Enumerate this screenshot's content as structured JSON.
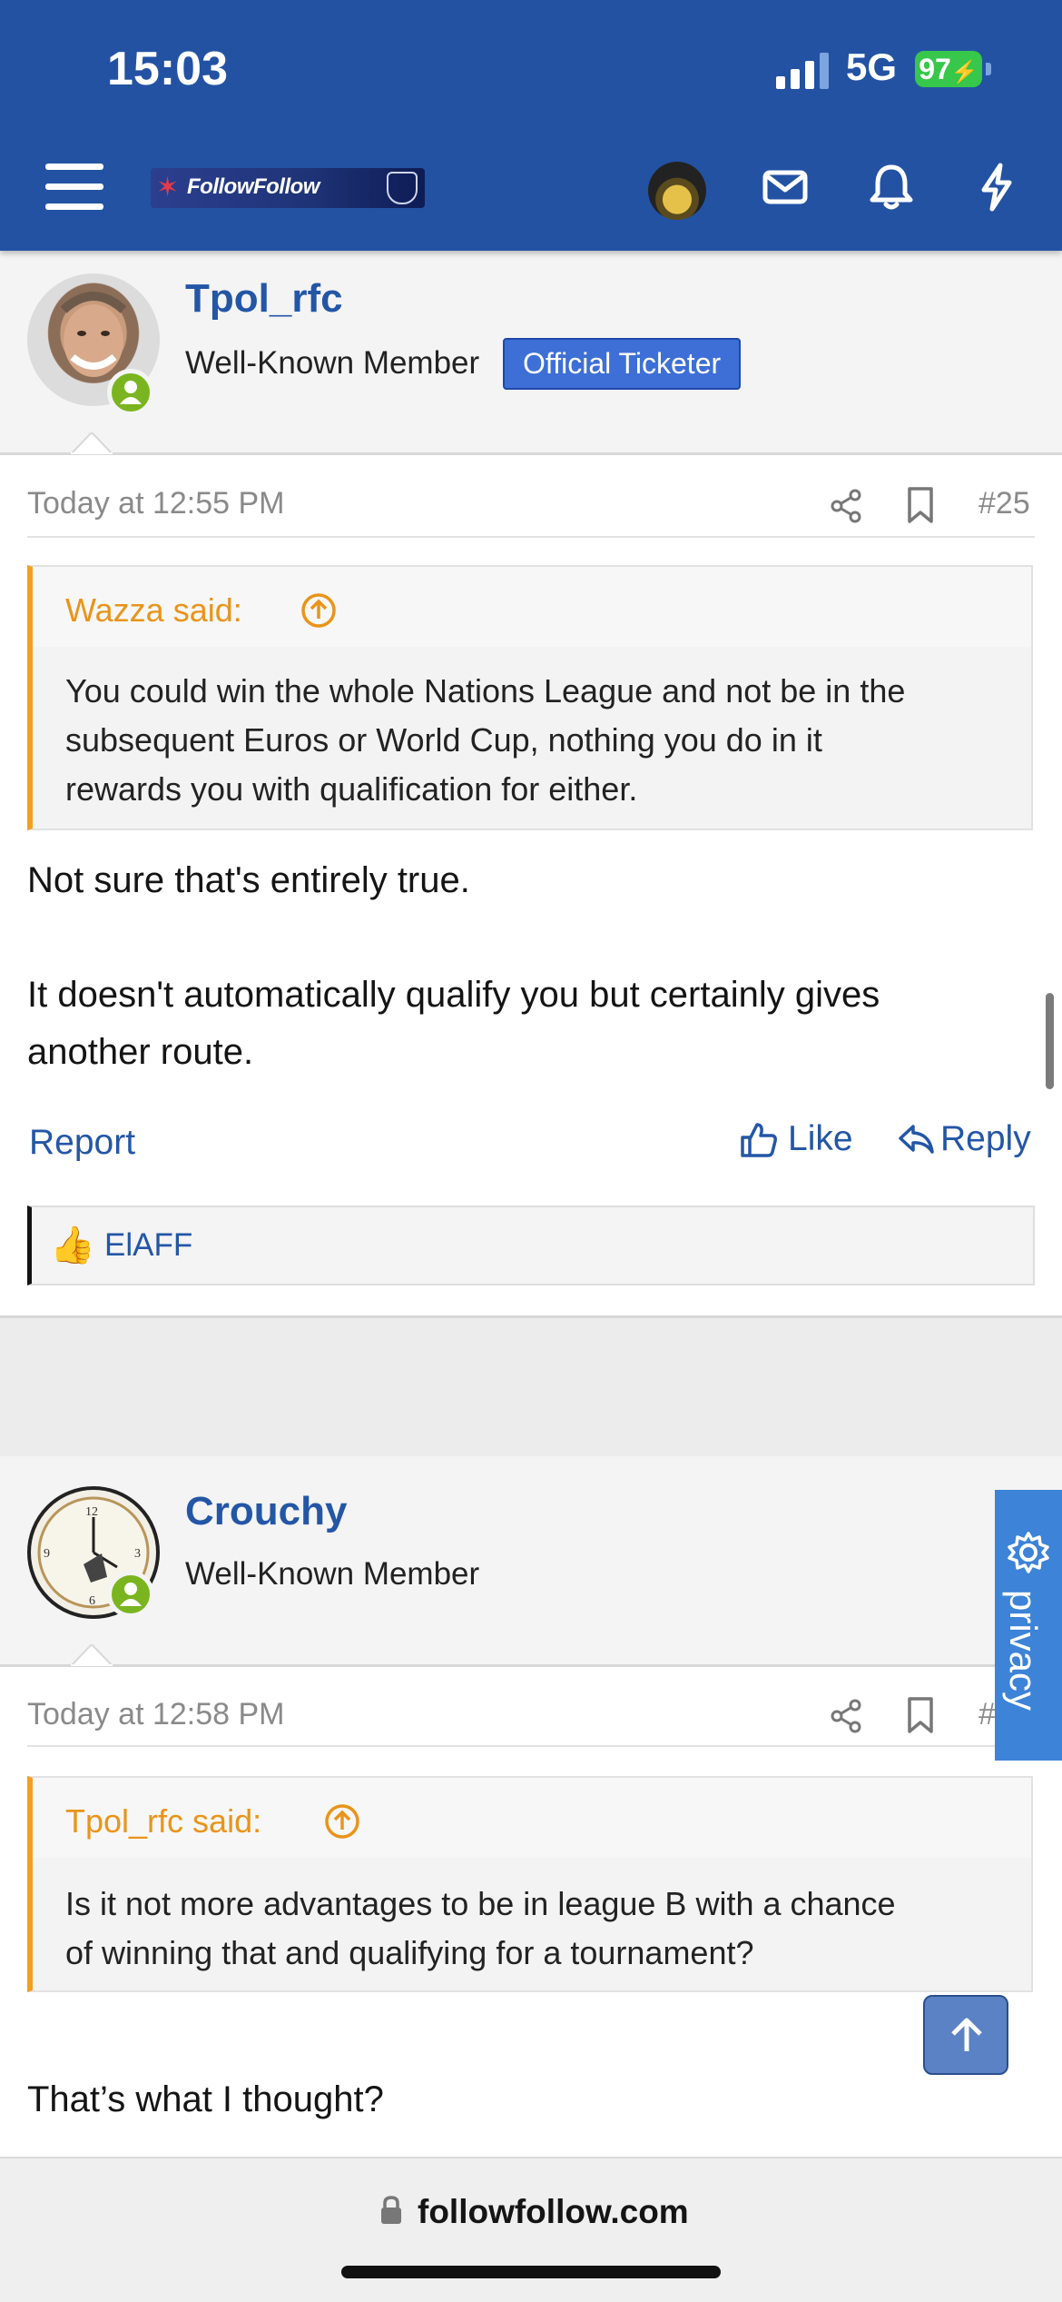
{
  "status_bar": {
    "time": "15:03",
    "network": "5G",
    "battery": "97"
  },
  "header": {
    "logo_text": "FollowFollow",
    "brand_color": "#2352a3"
  },
  "posts": [
    {
      "username": "Tpol_rfc",
      "user_title": "Well-Known Member",
      "banner": "Official Ticketer",
      "date": "Today at 12:55 PM",
      "post_number": "#25",
      "quote": {
        "author": "Wazza said:",
        "lines": [
          "You could win the whole Nations League and not be in the",
          "subsequent Euros or World Cup, nothing you do in it",
          "rewards you with qualification for either."
        ]
      },
      "message_lines": [
        "Not sure that's entirely true.",
        "It doesn't automatically qualify you but certainly gives",
        "another route."
      ],
      "actions": {
        "report": "Report",
        "like": "Like",
        "reply": "Reply"
      },
      "reaction_user": "ElAFF"
    },
    {
      "username": "Crouchy",
      "user_title": "Well-Known Member",
      "date": "Today at 12:58 PM",
      "post_number": "#",
      "quote": {
        "author": "Tpol_rfc said:",
        "lines": [
          "Is it not more advantages to be in league B with a chance",
          "of winning that and qualifying for a tournament?"
        ]
      },
      "message_lines": [
        "That’s what I thought?"
      ]
    }
  ],
  "privacy_label": "privacy",
  "browser": {
    "url": "followfollow.com"
  }
}
